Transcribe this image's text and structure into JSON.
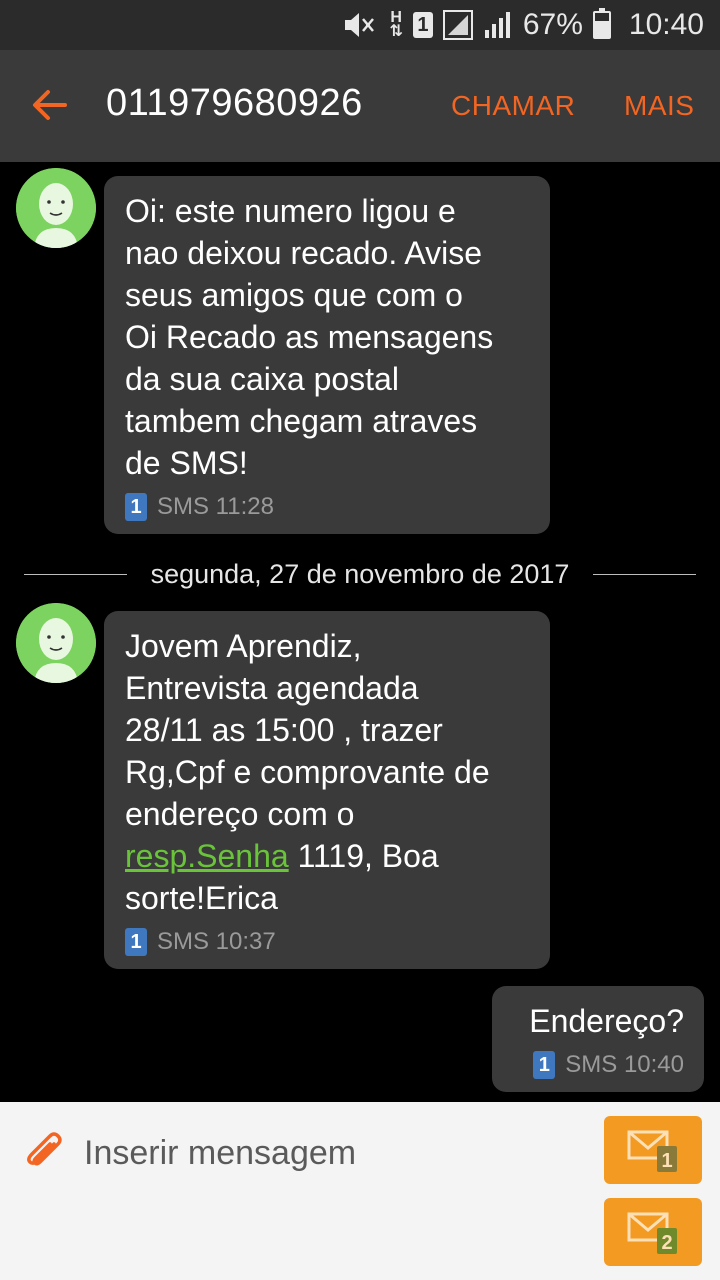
{
  "status_bar": {
    "battery_percent": "67%",
    "battery_level": 0.67,
    "time": "10:40",
    "sim_label": "1",
    "network_label": "H"
  },
  "toolbar": {
    "title": "011979680926",
    "call_label": "CHAMAR",
    "more_label": "MAIS"
  },
  "messages": [
    {
      "direction": "incoming",
      "text": "Oi: este numero ligou e\nnao deixou recado. Avise\nseus amigos que com o\nOi Recado as mensagens\nda sua caixa postal\ntambem chegam atraves\nde SMS!",
      "sim": "1",
      "meta": "SMS 11:28"
    },
    {
      "direction": "incoming",
      "text_before_link": "Jovem Aprendiz,\nEntrevista agendada\n28/11 as 15:00 , trazer\nRg,Cpf e comprovante de\nendereço com o\n",
      "link_text": "resp.Senha",
      "text_after_link": " 1119, Boa\nsorte!Erica",
      "sim": "1",
      "meta": "SMS 10:37"
    },
    {
      "direction": "outgoing",
      "text": "Endereço?",
      "sim": "1",
      "meta": "SMS 10:40"
    }
  ],
  "date_separator": "segunda, 27 de novembro de 2017",
  "composer": {
    "placeholder": "Inserir mensagem",
    "send_sim1": "1",
    "send_sim2": "2"
  },
  "colors": {
    "accent": "#f26522",
    "send_button": "#f29a22",
    "link": "#69c43a",
    "avatar": "#7cd35f",
    "sim_badge": "#3f78bf",
    "bubble": "#3a3a3a"
  }
}
